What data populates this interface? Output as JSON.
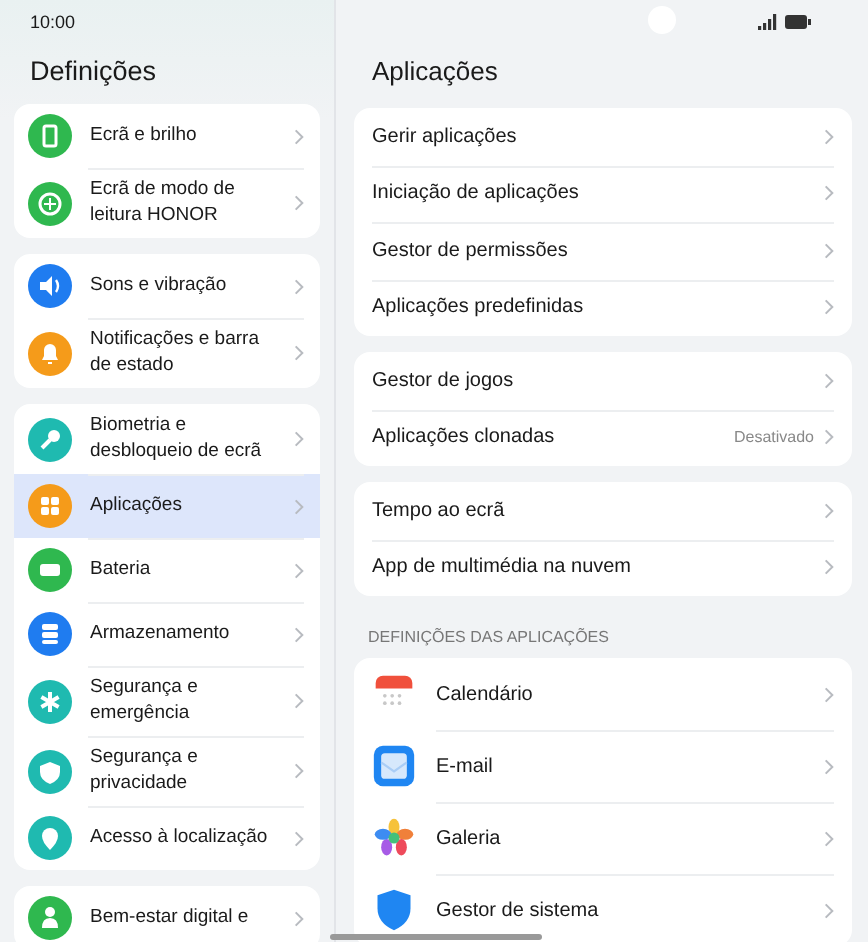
{
  "status_bar": {
    "time": "10:00"
  },
  "sidebar": {
    "title": "Definições",
    "sections": [
      {
        "items": [
          {
            "label": "Ecrã e brilho",
            "kind": "display",
            "color": "#2fb84f",
            "selected": false
          },
          {
            "label": "Ecrã de modo de leitura HONOR",
            "kind": "eye",
            "color": "#2fb84f",
            "selected": false
          }
        ]
      },
      {
        "items": [
          {
            "label": "Sons e vibração",
            "kind": "sound",
            "color": "#1f7cf0",
            "selected": false
          },
          {
            "label": "Notificações e barra de estado",
            "kind": "bell",
            "color": "#f59b1a",
            "selected": false
          }
        ]
      },
      {
        "items": [
          {
            "label": "Biometria e desbloqueio de ecrã",
            "kind": "key",
            "color": "#1fbab0",
            "selected": false
          },
          {
            "label": "Aplicações",
            "kind": "apps",
            "color": "#f59b1a",
            "selected": true
          },
          {
            "label": "Bateria",
            "kind": "battery",
            "color": "#2fb84f",
            "selected": false
          },
          {
            "label": "Armazenamento",
            "kind": "storage",
            "color": "#1f7cf0",
            "selected": false
          },
          {
            "label": "Segurança e emergência",
            "kind": "asterisk",
            "color": "#1fbab0",
            "selected": false
          },
          {
            "label": "Segurança e privacidade",
            "kind": "shield",
            "color": "#1fbab0",
            "selected": false
          },
          {
            "label": "Acesso à localização",
            "kind": "pin",
            "color": "#1fbab0",
            "selected": false
          }
        ]
      },
      {
        "items": [
          {
            "label": "Bem-estar digital e",
            "kind": "person",
            "color": "#2fb84f",
            "selected": false
          }
        ]
      }
    ]
  },
  "main": {
    "title": "Aplicações",
    "groups": [
      {
        "rows": [
          {
            "label": "Gerir aplicações"
          },
          {
            "label": "Iniciação de aplicações"
          },
          {
            "label": "Gestor de permissões"
          },
          {
            "label": "Aplicações predefinidas"
          }
        ]
      },
      {
        "rows": [
          {
            "label": "Gestor de jogos"
          },
          {
            "label": "Aplicações clonadas",
            "value": "Desativado"
          }
        ]
      },
      {
        "rows": [
          {
            "label": "Tempo ao ecrã"
          },
          {
            "label": "App de multimédia na nuvem"
          }
        ]
      }
    ],
    "app_settings": {
      "header": "DEFINIÇÕES DAS APLICAÇÕES",
      "rows": [
        {
          "label": "Calendário",
          "kind": "calendar"
        },
        {
          "label": "E-mail",
          "kind": "mail"
        },
        {
          "label": "Galeria",
          "kind": "gallery"
        },
        {
          "label": "Gestor de sistema",
          "kind": "system"
        }
      ]
    }
  }
}
